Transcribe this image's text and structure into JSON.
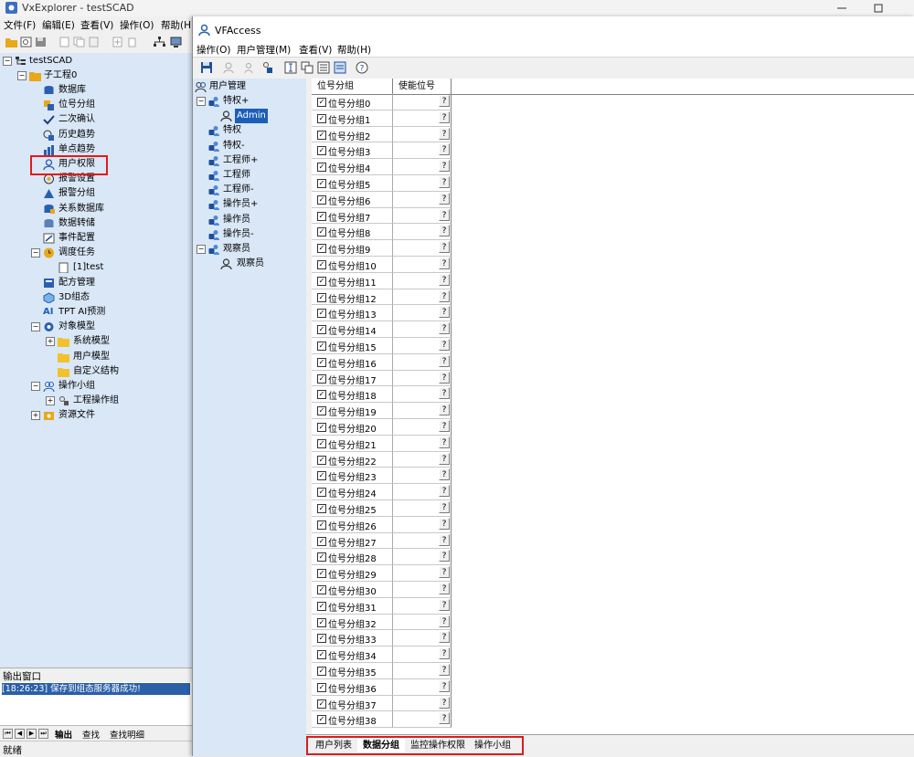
{
  "vx": {
    "title": "VxExplorer - testSCAD",
    "menu": [
      "文件(F)",
      "编辑(E)",
      "查看(V)",
      "操作(O)",
      "帮助(H"
    ],
    "tree": {
      "root": "testSCAD",
      "project": "子工程0",
      "items": [
        "数据库",
        "位号分组",
        "二次确认",
        "历史趋势",
        "单点趋势",
        "用户权限",
        "报警设置",
        "报警分组",
        "关系数据库",
        "数据转储",
        "事件配置",
        "调度任务",
        "[1]test",
        "配方管理",
        "3D组态",
        "TPT AI预测",
        "对象模型",
        "系统模型",
        "用户模型",
        "自定义结构",
        "操作小组",
        "工程操作组",
        "资源文件"
      ],
      "ai_prefix": "AI"
    },
    "output_title": "输出窗口",
    "output_line": "[18:26:23] 保存到组态服务器成功!",
    "output_tabs": [
      "输出",
      "查找",
      "查找明细"
    ],
    "status": "就绪"
  },
  "vf": {
    "title": "VFAccess",
    "menu": [
      "操作(O)",
      "用户管理(M)",
      "查看(V)",
      "帮助(H)"
    ],
    "tree": {
      "root": "用户管理",
      "groups": [
        {
          "label": "特权+",
          "children": [
            "Admin"
          ]
        },
        {
          "label": "特权",
          "children": []
        },
        {
          "label": "特权-",
          "children": []
        },
        {
          "label": "工程师+",
          "children": []
        },
        {
          "label": "工程师",
          "children": []
        },
        {
          "label": "工程师-",
          "children": []
        },
        {
          "label": "操作员+",
          "children": []
        },
        {
          "label": "操作员",
          "children": []
        },
        {
          "label": "操作员-",
          "children": []
        },
        {
          "label": "观察员",
          "children": [
            "观察员"
          ]
        }
      ],
      "selected": "Admin"
    },
    "grid": {
      "columns": [
        "位号分组",
        "使能位号"
      ],
      "rows": [
        "位号分组0",
        "位号分组1",
        "位号分组2",
        "位号分组3",
        "位号分组4",
        "位号分组5",
        "位号分组6",
        "位号分组7",
        "位号分组8",
        "位号分组9",
        "位号分组10",
        "位号分组11",
        "位号分组12",
        "位号分组13",
        "位号分组14",
        "位号分组15",
        "位号分组16",
        "位号分组17",
        "位号分组18",
        "位号分组19",
        "位号分组20",
        "位号分组21",
        "位号分组22",
        "位号分组23",
        "位号分组24",
        "位号分组25",
        "位号分组26",
        "位号分组27",
        "位号分组28",
        "位号分组29",
        "位号分组30",
        "位号分组31",
        "位号分组32",
        "位号分组33",
        "位号分组34",
        "位号分组35",
        "位号分组36",
        "位号分组37",
        "位号分组38"
      ],
      "checkmark": "✓",
      "button_label": "?"
    },
    "tabs": [
      "用户列表",
      "数据分组",
      "监控操作权限",
      "操作小组"
    ],
    "active_tab": "数据分组"
  },
  "colors": {
    "highlight_red": "#e21a1a",
    "tree_bg": "#d9e7f7",
    "selection_blue": "#1b5fb8"
  },
  "window_controls": [
    "minimize",
    "maximize"
  ]
}
